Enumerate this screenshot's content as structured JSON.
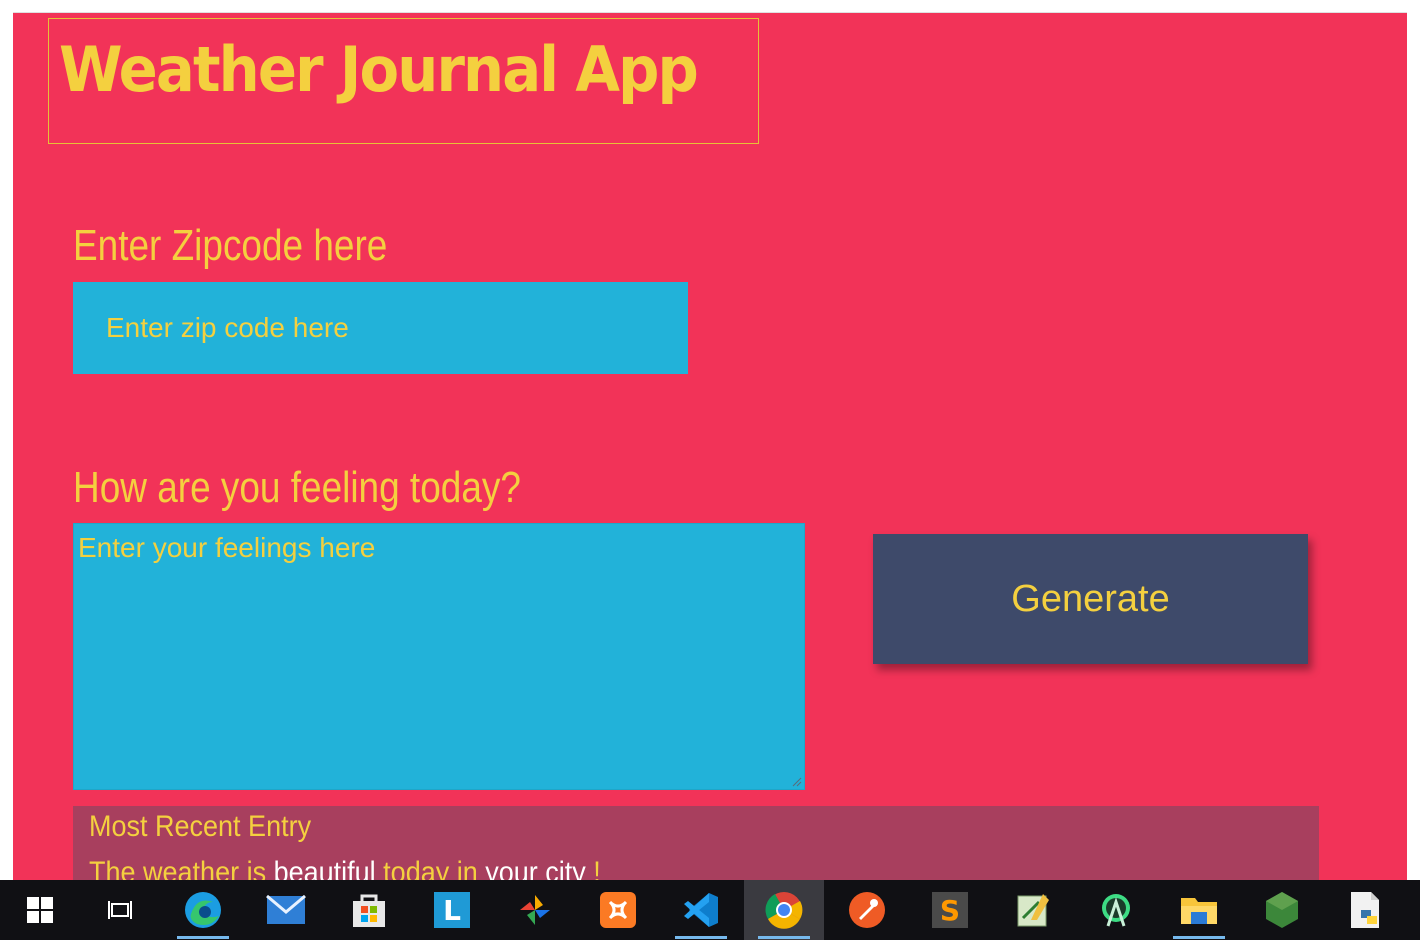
{
  "app": {
    "title": "Weather Journal App",
    "zip": {
      "label": "Enter Zipcode here",
      "placeholder": "Enter zip code here"
    },
    "feelings": {
      "label": "How are you feeling today?",
      "placeholder": "Enter your feelings here"
    },
    "generate_label": "Generate",
    "entry": {
      "title": "Most Recent Entry",
      "text_parts": [
        "The weather is ",
        "beautiful",
        " today in ",
        "your city",
        " !"
      ]
    },
    "colors": {
      "background": "#f23358",
      "accent": "#f4d03f",
      "input": "#22b2d9",
      "button": "#3e4a6a",
      "entry": "#a83f5e"
    }
  },
  "taskbar": {
    "items": [
      {
        "icon": "windows-start-icon"
      },
      {
        "icon": "task-view-icon"
      },
      {
        "icon": "edge-icon",
        "running": true
      },
      {
        "icon": "mail-icon"
      },
      {
        "icon": "store-icon"
      },
      {
        "icon": "l-app-icon",
        "letter": "L"
      },
      {
        "icon": "photos-icon"
      },
      {
        "icon": "xampp-icon"
      },
      {
        "icon": "vscode-icon",
        "running": true
      },
      {
        "icon": "chrome-icon",
        "running": true,
        "active": true
      },
      {
        "icon": "postman-icon"
      },
      {
        "icon": "sublime-icon",
        "letter": "S"
      },
      {
        "icon": "notepad-icon"
      },
      {
        "icon": "android-studio-icon"
      },
      {
        "icon": "file-explorer-icon",
        "running": true
      },
      {
        "icon": "node-icon"
      },
      {
        "icon": "python-file-icon"
      }
    ]
  }
}
